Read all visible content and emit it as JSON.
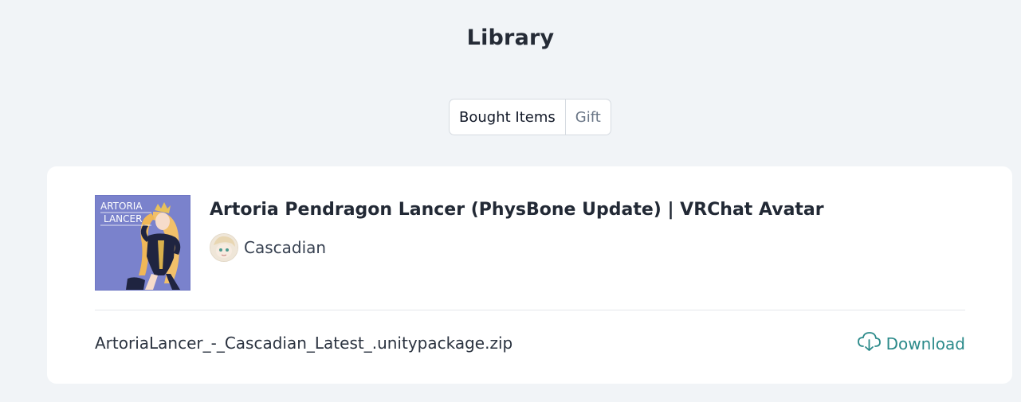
{
  "page": {
    "title": "Library"
  },
  "tabs": [
    {
      "label": "Bought Items",
      "active": true
    },
    {
      "label": "Gift",
      "active": false
    }
  ],
  "item": {
    "title": "Artoria Pendragon Lancer (PhysBone Update) | VRChat Avatar",
    "thumbnail": {
      "line1": "ARTORIA",
      "line2": "LANCER"
    },
    "author": {
      "name": "Cascadian"
    },
    "file": {
      "name": "ArtoriaLancer_-_Cascadian_Latest_.unitypackage.zip"
    },
    "download_label": "Download"
  },
  "colors": {
    "background": "#f1f4f7",
    "card": "#ffffff",
    "accent": "#2b8a8a",
    "thumbnail_bg": "#7a82cc"
  },
  "icons": {
    "download": "cloud-download-icon"
  }
}
